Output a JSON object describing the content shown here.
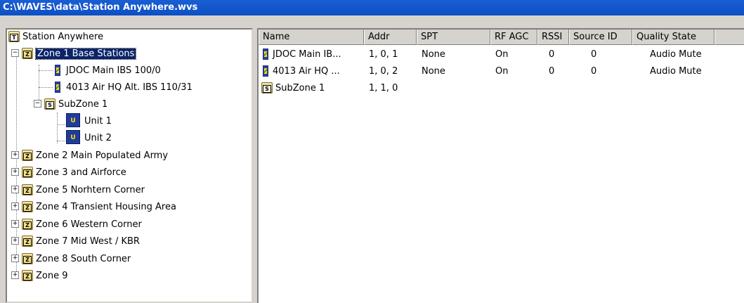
{
  "window": {
    "title": "C:\\WAVES\\data\\Station Anywhere.wvs"
  },
  "tree": {
    "root": {
      "label": "Station Anywhere",
      "badge": "T"
    },
    "zone1": {
      "label": "Zone 1 Base Stations",
      "badge": "Z"
    },
    "zone1_children": [
      {
        "label": "JDOC Main IBS 100/0"
      },
      {
        "label": "4013 Air HQ Alt. IBS 110/31"
      }
    ],
    "subzone": {
      "label": "SubZone 1",
      "badge": "S"
    },
    "units": [
      {
        "label": "Unit 1",
        "badge": "U"
      },
      {
        "label": "Unit 2",
        "badge": "U"
      }
    ],
    "zones": [
      {
        "label": "Zone 2 Main Populated Army",
        "badge": "Z"
      },
      {
        "label": "Zone 3 and Airforce",
        "badge": "Z"
      },
      {
        "label": "Zone 5 Norhtern Corner",
        "badge": "Z"
      },
      {
        "label": "Zone 4 Transient Housing Area",
        "badge": "Z"
      },
      {
        "label": "Zone 6 Western Corner",
        "badge": "Z"
      },
      {
        "label": "Zone 7 Mid West / KBR",
        "badge": "Z"
      },
      {
        "label": "Zone 8 South Corner",
        "badge": "Z"
      },
      {
        "label": "Zone 9",
        "badge": "Z"
      }
    ],
    "expand_minus": "−",
    "expand_plus": "+"
  },
  "list": {
    "columns": [
      "Name",
      "Addr",
      "SPT",
      "RF AGC",
      "RSSI",
      "Source ID",
      "Quality State"
    ],
    "rows": [
      {
        "name": "JDOC Main IB...",
        "addr": "1, 0, 1",
        "spt": "None",
        "rfagc": "On",
        "rssi": "0",
        "source": "0",
        "quality": "Audio Mute"
      },
      {
        "name": "4013 Air HQ ...",
        "addr": "1, 0, 2",
        "spt": "None",
        "rfagc": "On",
        "rssi": "0",
        "source": "0",
        "quality": "Audio Mute"
      },
      {
        "name": "SubZone 1",
        "addr": "1, 1, 0",
        "spt": "",
        "rfagc": "",
        "rssi": "",
        "source": "",
        "quality": ""
      }
    ],
    "subzone_badge": "S"
  }
}
